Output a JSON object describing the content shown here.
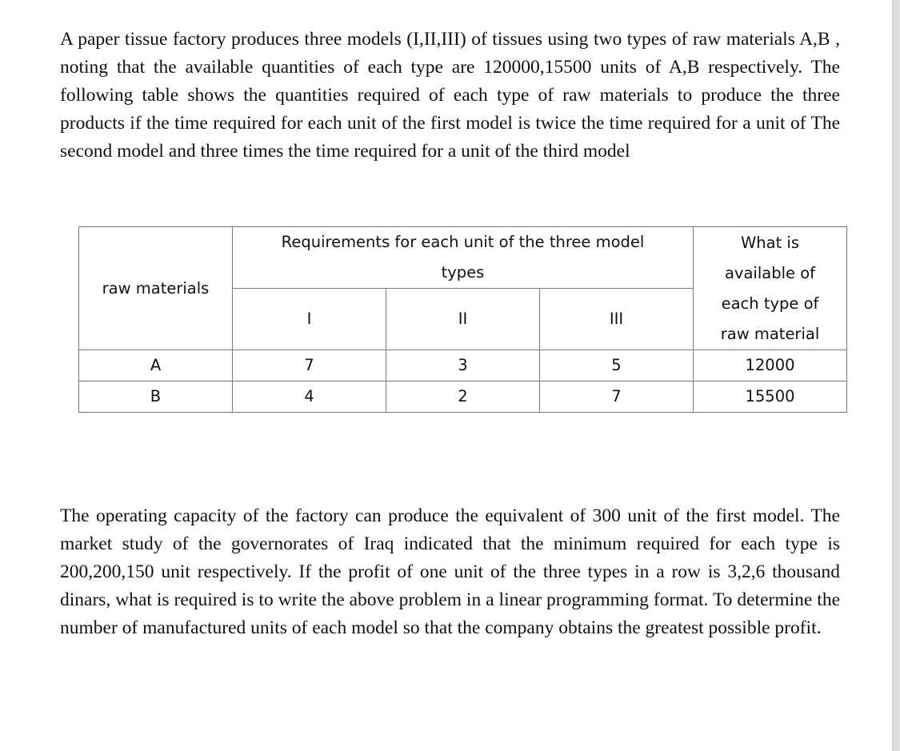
{
  "document": {
    "paragraph1": "A paper tissue factory produces three models (I,II,III) of tissues using two types of raw materials A,B  , noting that the available quantities of each type are 120000,15500 units of A,B respectively. The following table shows the quantities required of each type of raw materials to produce the three products if the time required for each unit of the first model is twice the time required for a unit of The second model and three times the time required for a unit of the third model",
    "table": {
      "header_raw_materials": "raw materials",
      "header_requirements_line1": "Requirements for each unit of the three model",
      "header_requirements_line2": "types",
      "header_available": [
        "What is",
        "available of",
        "each type of",
        "raw material"
      ],
      "model_columns": [
        "I",
        "II",
        "III"
      ],
      "rows": [
        {
          "material": "A",
          "values": [
            "7",
            "3",
            "5"
          ],
          "available": "12000"
        },
        {
          "material": "B",
          "values": [
            "4",
            "2",
            "7"
          ],
          "available": "15500"
        }
      ]
    },
    "paragraph2": "The operating capacity of the factory can produce the equivalent of 300 unit of the first model. The market study of the governorates of Iraq indicated that the minimum required for each type is  200,200,150 unit respectively. If the profit of one unit of the three types in a row is 3,2,6 thousand dinars, what is required is to write the above problem in a linear programming format. To determine the number of manufactured units of each model so that the company obtains the greatest possible profit."
  }
}
